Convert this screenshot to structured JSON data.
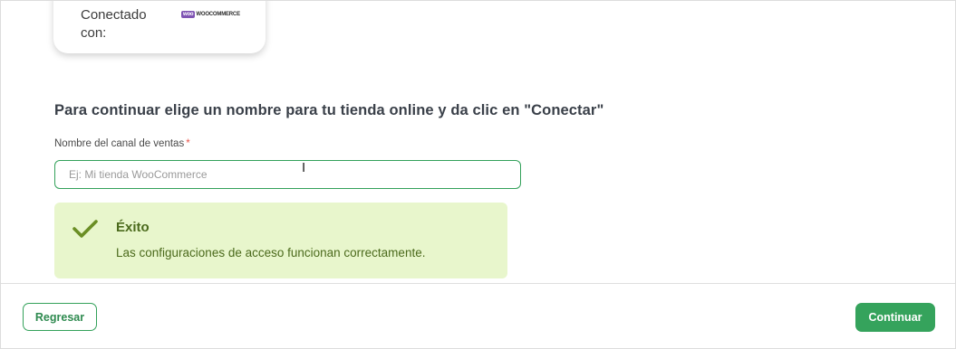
{
  "connection": {
    "label": "Conectado con:",
    "platform_logo_text": "WOOCOMMERCE",
    "platform_logo_color": "#7f54b3"
  },
  "instruction": "Para continuar elige un nombre para tu tienda online y da clic en \"Conectar\"",
  "channel_field": {
    "label": "Nombre del canal de ventas",
    "required_mark": "*",
    "placeholder": "Ej: Mi tienda WooCommerce",
    "value": ""
  },
  "alert": {
    "type": "success",
    "icon": "check-icon",
    "title": "Éxito",
    "message": "Las configuraciones de acceso funcionan correctamente.",
    "background": "#e8f6cc",
    "text_color": "#4b6a1c"
  },
  "footer": {
    "back_label": "Regresar",
    "continue_label": "Continuar",
    "accent_color": "#35a35c"
  }
}
